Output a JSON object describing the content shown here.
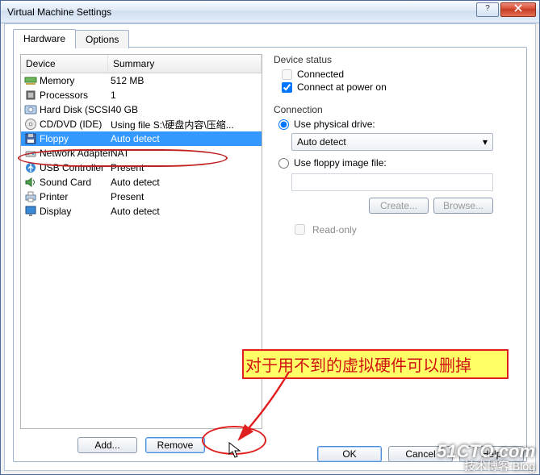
{
  "window": {
    "title": "Virtual Machine Settings"
  },
  "tabs": {
    "hardware": "Hardware",
    "options": "Options"
  },
  "list": {
    "hdr_device": "Device",
    "hdr_summary": "Summary",
    "rows": [
      {
        "name": "Memory",
        "summary": "512 MB",
        "icon": "memory"
      },
      {
        "name": "Processors",
        "summary": "1",
        "icon": "cpu"
      },
      {
        "name": "Hard Disk (SCSI)",
        "summary": "40 GB",
        "icon": "hdd"
      },
      {
        "name": "CD/DVD (IDE)",
        "summary": "Using file S:\\硬盘内容\\压缩...",
        "icon": "cd"
      },
      {
        "name": "Floppy",
        "summary": "Auto detect",
        "icon": "floppy",
        "selected": true
      },
      {
        "name": "Network Adapter",
        "summary": "NAT",
        "icon": "net"
      },
      {
        "name": "USB Controller",
        "summary": "Present",
        "icon": "usb"
      },
      {
        "name": "Sound Card",
        "summary": "Auto detect",
        "icon": "sound"
      },
      {
        "name": "Printer",
        "summary": "Present",
        "icon": "printer"
      },
      {
        "name": "Display",
        "summary": "Auto detect",
        "icon": "display"
      }
    ]
  },
  "left_buttons": {
    "add": "Add...",
    "remove": "Remove"
  },
  "right": {
    "status_title": "Device status",
    "connected": "Connected",
    "connect_power": "Connect at power on",
    "conn_title": "Connection",
    "use_physical": "Use physical drive:",
    "physical_value": "Auto detect",
    "use_image": "Use floppy image file:",
    "create": "Create...",
    "browse": "Browse...",
    "readonly": "Read-only"
  },
  "footer": {
    "ok": "OK",
    "cancel": "Cancel",
    "help": "Help"
  },
  "annotation": "对于用不到的虚拟硬件可以删掉",
  "watermark": {
    "main": "51CTO.com",
    "sub": "技术博客 Blog"
  }
}
